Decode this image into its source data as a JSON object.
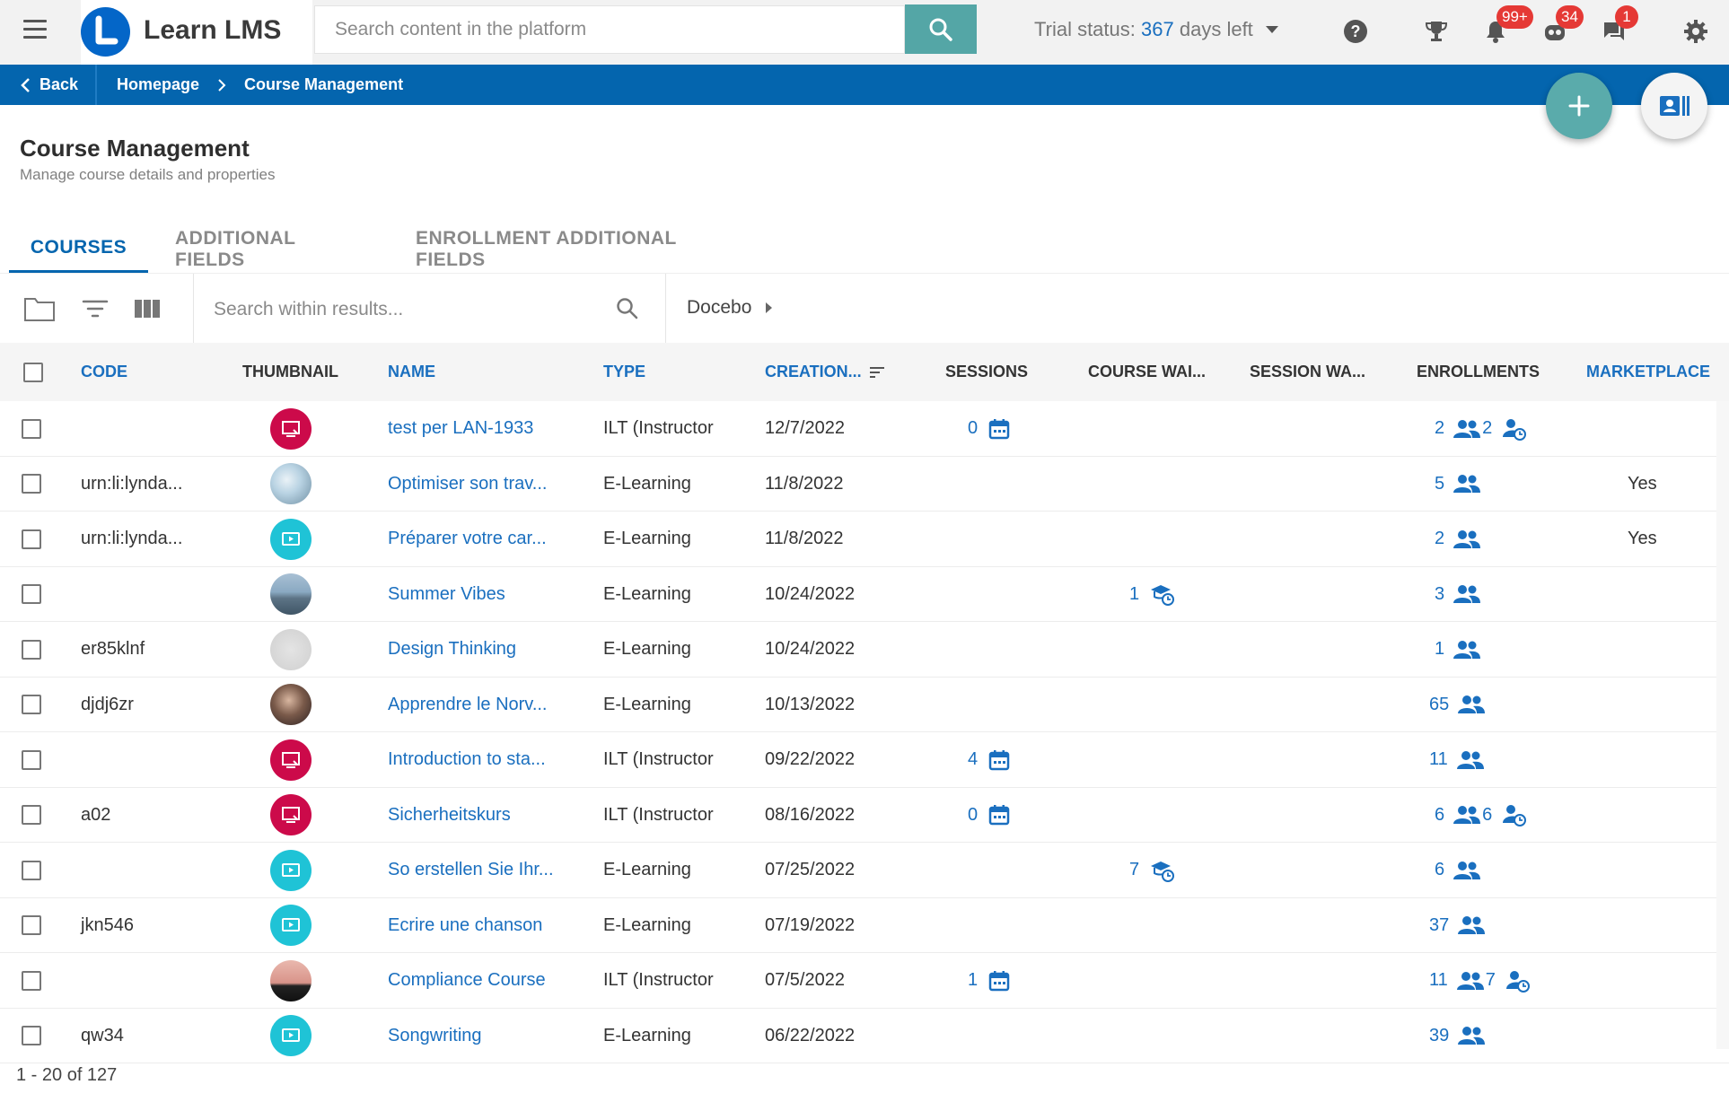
{
  "app": {
    "name": "Learn LMS",
    "search_placeholder": "Search content in the platform",
    "trial_prefix": "Trial status:",
    "trial_days": "367",
    "trial_suffix": "days left",
    "badges": {
      "notifications": "99+",
      "bot": "34",
      "messages": "1"
    }
  },
  "breadcrumb": {
    "back": "Back",
    "items": [
      "Homepage",
      "Course Management"
    ]
  },
  "page": {
    "title": "Course Management",
    "subtitle": "Manage course details and properties"
  },
  "tabs": [
    "COURSES",
    "ADDITIONAL FIELDS",
    "ENROLLMENT ADDITIONAL FIELDS"
  ],
  "toolbar": {
    "search_placeholder": "Search within results...",
    "folder": "Docebo"
  },
  "table": {
    "columns": {
      "code": "CODE",
      "thumbnail": "THUMBNAIL",
      "name": "NAME",
      "type": "TYPE",
      "creation": "CREATION...",
      "sessions": "SESSIONS",
      "course_waiting": "COURSE WAI...",
      "session_waiting": "SESSION WA...",
      "enrollments": "ENROLLMENTS",
      "marketplace": "MARKETPLACE"
    },
    "rows": [
      {
        "code": "",
        "thumb": "ilt",
        "name": "test per LAN-1933",
        "type": "ILT (Instructor",
        "created": "12/7/2022",
        "sessions": "0",
        "course_wait": "",
        "enroll": "2",
        "enroll_wait": "2",
        "marketplace": ""
      },
      {
        "code": "urn:li:lynda...",
        "thumb": "photo-desk",
        "name": "Optimiser son trav...",
        "type": "E-Learning",
        "created": "11/8/2022",
        "sessions": "",
        "course_wait": "",
        "enroll": "5",
        "enroll_wait": "",
        "marketplace": "Yes"
      },
      {
        "code": "urn:li:lynda...",
        "thumb": "video",
        "name": "Préparer votre car...",
        "type": "E-Learning",
        "created": "11/8/2022",
        "sessions": "",
        "course_wait": "",
        "enroll": "2",
        "enroll_wait": "",
        "marketplace": "Yes"
      },
      {
        "code": "",
        "thumb": "photo-sea",
        "name": "Summer Vibes",
        "type": "E-Learning",
        "created": "10/24/2022",
        "sessions": "",
        "course_wait": "1",
        "enroll": "3",
        "enroll_wait": "",
        "marketplace": ""
      },
      {
        "code": "er85klnf",
        "thumb": "photo-gray",
        "name": "Design Thinking",
        "type": "E-Learning",
        "created": "10/24/2022",
        "sessions": "",
        "course_wait": "",
        "enroll": "1",
        "enroll_wait": "",
        "marketplace": ""
      },
      {
        "code": "djdj6zr",
        "thumb": "photo-person",
        "name": "Apprendre le Norv...",
        "type": "E-Learning",
        "created": "10/13/2022",
        "sessions": "",
        "course_wait": "",
        "enroll": "65",
        "enroll_wait": "",
        "marketplace": ""
      },
      {
        "code": "",
        "thumb": "ilt",
        "name": "Introduction to sta...",
        "type": "ILT (Instructor",
        "created": "09/22/2022",
        "sessions": "4",
        "course_wait": "",
        "enroll": "11",
        "enroll_wait": "",
        "marketplace": ""
      },
      {
        "code": "a02",
        "thumb": "ilt",
        "name": "Sicherheitskurs",
        "type": "ILT (Instructor",
        "created": "08/16/2022",
        "sessions": "0",
        "course_wait": "",
        "enroll": "6",
        "enroll_wait": "6",
        "marketplace": ""
      },
      {
        "code": "",
        "thumb": "video",
        "name": "So erstellen Sie Ihr...",
        "type": "E-Learning",
        "created": "07/25/2022",
        "sessions": "",
        "course_wait": "7",
        "enroll": "6",
        "enroll_wait": "",
        "marketplace": ""
      },
      {
        "code": "jkn546",
        "thumb": "video",
        "name": "Ecrire une chanson",
        "type": "E-Learning",
        "created": "07/19/2022",
        "sessions": "",
        "course_wait": "",
        "enroll": "37",
        "enroll_wait": "",
        "marketplace": ""
      },
      {
        "code": "",
        "thumb": "photo-pink",
        "name": "Compliance Course",
        "type": "ILT (Instructor",
        "created": "07/5/2022",
        "sessions": "1",
        "course_wait": "",
        "enroll": "11",
        "enroll_wait": "7",
        "marketplace": ""
      },
      {
        "code": "qw34",
        "thumb": "video",
        "name": "Songwriting",
        "type": "E-Learning",
        "created": "06/22/2022",
        "sessions": "",
        "course_wait": "",
        "enroll": "39",
        "enroll_wait": "",
        "marketplace": ""
      }
    ]
  },
  "pagination": {
    "summary": "1 - 20 of 127"
  },
  "colors": {
    "brand": "#0465ae",
    "accent_teal": "#54a6a6",
    "link": "#1a6fbf",
    "ilt_thumb": "#cc0a4a",
    "video_thumb": "#1fc3d6",
    "badge": "#e53935"
  }
}
